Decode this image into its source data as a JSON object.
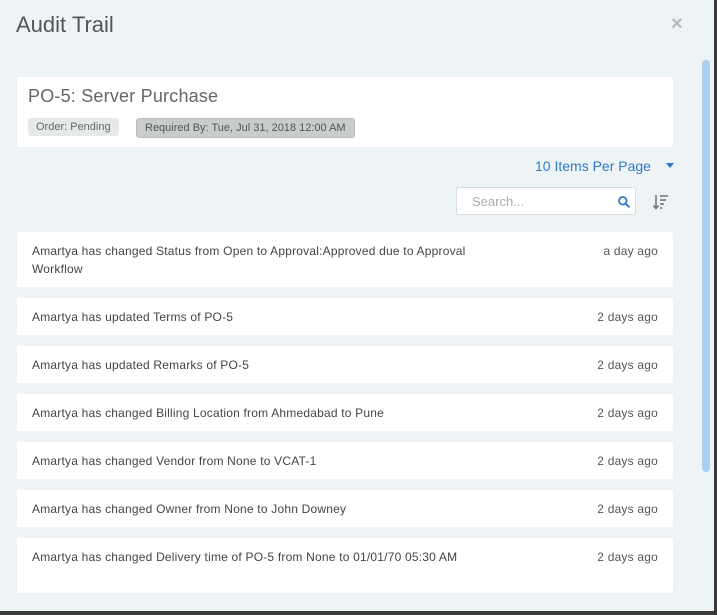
{
  "modal": {
    "title": "Audit Trail",
    "close_label": "×"
  },
  "po": {
    "title": "PO-5: Server Purchase",
    "status_badge": "Order: Pending",
    "required_badge": "Required By: Tue, Jul 31, 2018 12:00 AM"
  },
  "pager": {
    "label": "10 Items Per Page"
  },
  "search": {
    "placeholder": "Search...",
    "value": ""
  },
  "entries": [
    {
      "text": "Amartya has changed Status from Open to Approval:Approved due to Approval Workflow",
      "time": "a day ago"
    },
    {
      "text": "Amartya has updated Terms of PO-5",
      "time": "2 days ago"
    },
    {
      "text": "Amartya has updated Remarks of PO-5",
      "time": "2 days ago"
    },
    {
      "text": "Amartya has changed Billing Location from Ahmedabad to Pune",
      "time": "2 days ago"
    },
    {
      "text": "Amartya has changed Vendor from None to VCAT-1",
      "time": "2 days ago"
    },
    {
      "text": "Amartya has changed Owner from None to John Downey",
      "time": "2 days ago"
    },
    {
      "text": "Amartya has changed Delivery time of PO-5 from None to 01/01/70 05:30 AM",
      "time": "2 days ago"
    }
  ],
  "colors": {
    "accent": "#2f79c8",
    "background": "#eef3f6",
    "scrollbar": "#aad0ee"
  },
  "icons": {
    "close": "close-icon",
    "search": "search-icon",
    "sort": "sort-icon",
    "pager": "chevron-down-icon"
  }
}
